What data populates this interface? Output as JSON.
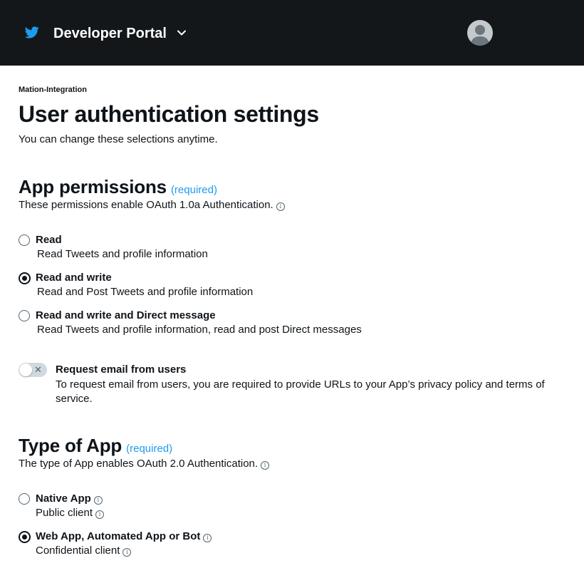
{
  "header": {
    "title": "Developer Portal",
    "logo_icon": "twitter-bird-icon",
    "dropdown_icon": "chevron-down-icon",
    "avatar_icon": "user-avatar-icon",
    "background": "#14171a",
    "brand_color": "#1d9bf0"
  },
  "project_name": "Mation-Integration",
  "page_title": "User authentication settings",
  "page_subtitle": "You can change these selections anytime.",
  "app_permissions": {
    "title": "App permissions",
    "required": "(required)",
    "description": "These permissions enable OAuth 1.0a Authentication.",
    "selected": "read_write",
    "options": [
      {
        "id": "read",
        "label": "Read",
        "description": "Read Tweets and profile information",
        "checked": false
      },
      {
        "id": "read_write",
        "label": "Read and write",
        "description": "Read and Post Tweets and profile information",
        "checked": true
      },
      {
        "id": "read_write_dm",
        "label": "Read and write and Direct message",
        "description": "Read Tweets and profile information, read and post Direct messages",
        "checked": false
      }
    ],
    "email_toggle": {
      "label": "Request email from users",
      "description": "To request email from users, you are required to provide URLs to your App’s privacy policy and terms of service.",
      "on": false
    }
  },
  "type_of_app": {
    "title": "Type of App",
    "required": "(required)",
    "description": "The type of App enables OAuth 2.0 Authentication.",
    "selected": "web_app",
    "options": [
      {
        "id": "native_app",
        "label": "Native App",
        "description": "Public client",
        "checked": false
      },
      {
        "id": "web_app",
        "label": "Web App, Automated App or Bot",
        "description": "Confidential client",
        "checked": true
      }
    ]
  },
  "info_icon": "ⓘ"
}
